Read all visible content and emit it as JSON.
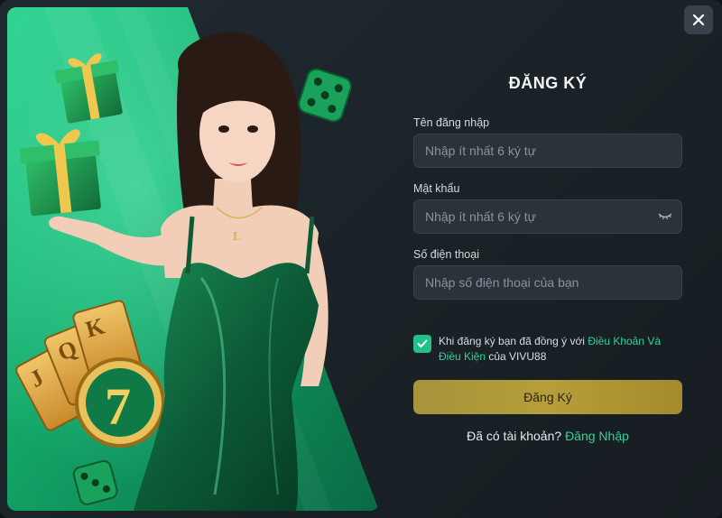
{
  "dialog": {
    "title": "ĐĂNG KÝ",
    "close_icon": "close-icon"
  },
  "form": {
    "username": {
      "label": "Tên đăng nhập",
      "placeholder": "Nhập ít nhất 6 ký tự",
      "value": ""
    },
    "password": {
      "label": "Mật khẩu",
      "placeholder": "Nhập ít nhất 6 ký tự",
      "value": "",
      "toggle_icon": "eye-closed-icon"
    },
    "phone": {
      "label": "Số điện thoại",
      "placeholder": "Nhập số điện thoại của bạn",
      "value": ""
    },
    "agree": {
      "checked": true,
      "text_before": "Khi đăng ký bạn đã đồng ý với ",
      "terms_link": "Điều Khoản Và Điều Kiện",
      "text_after": " của VIVU88"
    },
    "submit_label": "Đăng Ký",
    "login_prompt": "Đã có tài khoản?",
    "login_link": "Đăng Nhập"
  },
  "promo": {
    "image": "casino-promo-illustration"
  },
  "colors": {
    "accent_green": "#2fd39a",
    "button_gold": "#b69e3a",
    "panel_bg": "#1c252b"
  }
}
